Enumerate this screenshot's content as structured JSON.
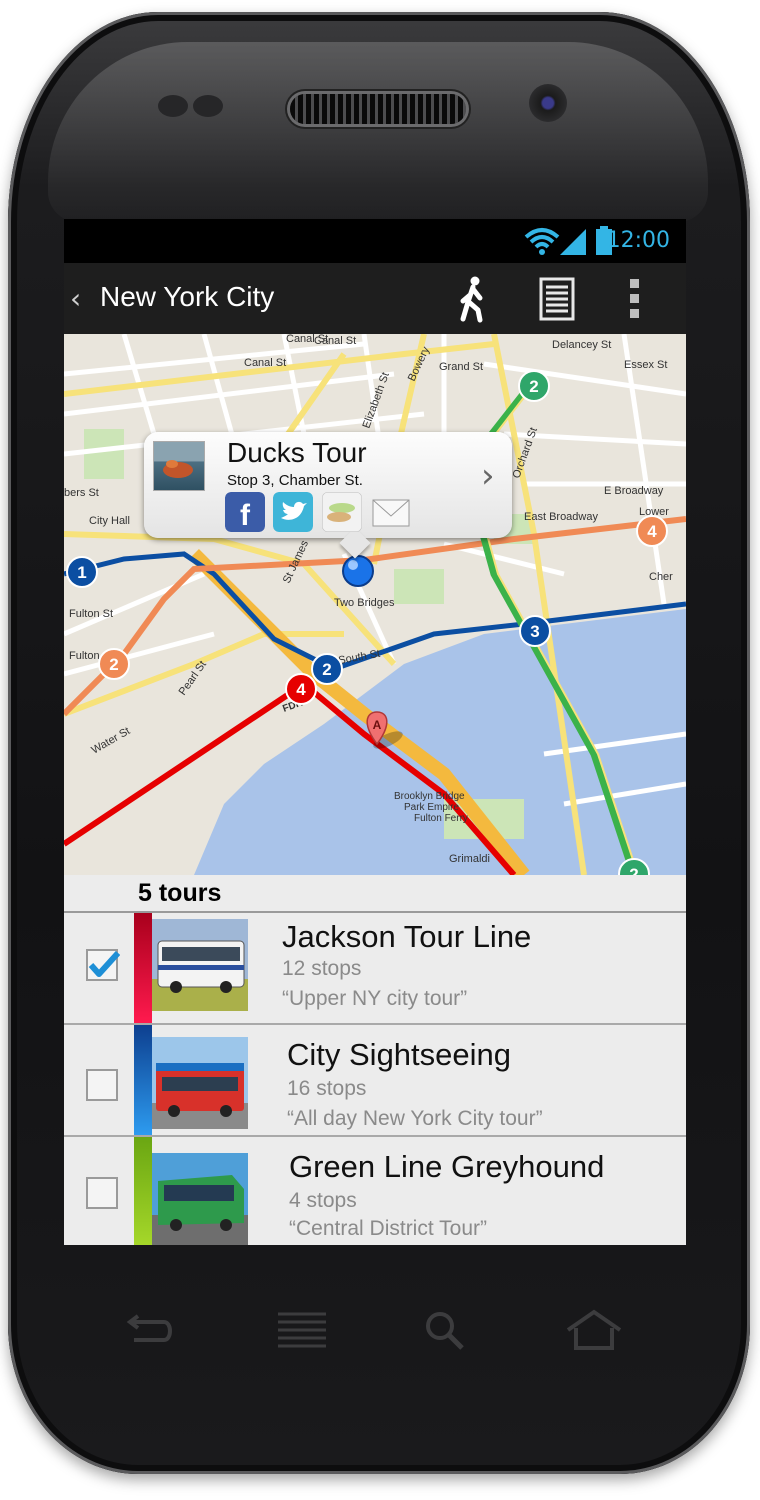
{
  "status_bar": {
    "time": "12:00"
  },
  "action_bar": {
    "back_glyph": "‹",
    "title": "New York City"
  },
  "map": {
    "street_labels": [
      "Canal St",
      "Canal St",
      "Canal St",
      "Grand St",
      "Delancey St",
      "Essex St",
      "Bowery",
      "Elizabeth St",
      "Orchard St",
      "bers St",
      "City Hall",
      "Fulton St",
      "Fulton",
      "Pearl St",
      "Water St",
      "St James",
      "South St",
      "E Broadway",
      "East Broadway",
      "Lower",
      "Cher",
      "Two Bridges",
      "Brooklyn Bridge",
      "Park Empire",
      "Fulton Ferry",
      "Grimaldi",
      "FDR"
    ],
    "route_markers": [
      {
        "label": "1",
        "color": "#0b4ea2"
      },
      {
        "label": "2",
        "color": "#f08a55"
      },
      {
        "label": "2",
        "color": "#0b4ea2"
      },
      {
        "label": "3",
        "color": "#0b4ea2"
      },
      {
        "label": "4",
        "color": "#e60000"
      },
      {
        "label": "4",
        "color": "#f08a55"
      },
      {
        "label": "2",
        "color": "#2fa66a"
      },
      {
        "label": "2",
        "color": "#2fa66a"
      }
    ],
    "pin_label": "A",
    "popup": {
      "title": "Ducks Tour",
      "subtitle": "Stop 3, Chamber St.",
      "arrow": "›",
      "share_icons": [
        "facebook-icon",
        "twitter-icon",
        "chat-icon",
        "email-icon"
      ]
    }
  },
  "list": {
    "header": "5 tours",
    "tours": [
      {
        "name": "Jackson Tour Line",
        "stops": "12 stops",
        "desc": "“Upper NY city tour”",
        "checked": true,
        "color": "#e0103a"
      },
      {
        "name": "City Sightseeing",
        "stops": "16 stops",
        "desc": "“All day New York City tour”",
        "checked": false,
        "color": "#1e73c8"
      },
      {
        "name": "Green Line Greyhound",
        "stops": "4 stops",
        "desc": "“Central District Tour”",
        "checked": false,
        "color": "#8ec21a"
      }
    ]
  },
  "nav_bar": {
    "icons": [
      "back-icon",
      "menu-icon",
      "search-icon",
      "home-icon"
    ]
  },
  "colors": {
    "holo_blue": "#33b5e5",
    "route_blue": "#0b4ea2",
    "route_orange": "#f08a55",
    "route_red": "#e60000",
    "route_green": "#2fa66a"
  }
}
